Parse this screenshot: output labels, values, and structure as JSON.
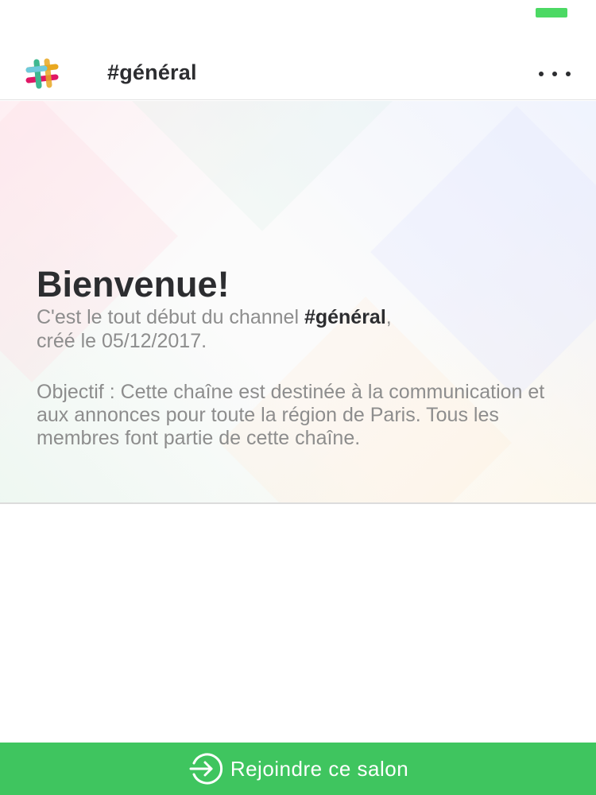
{
  "colors": {
    "accent_green": "#3fc55f",
    "battery_green": "#4cd964"
  },
  "header": {
    "channel_name": "#général",
    "logo_icon": "slack-logo-icon",
    "more_icon": "more-horizontal-icon"
  },
  "intro": {
    "title": "Bienvenue!",
    "created_prefix": "C'est le tout début du channel ",
    "created_channel": "#général",
    "created_suffix": ",",
    "created_date": "créé le 05/12/2017.",
    "purpose": "Objectif : Cette chaîne est destinée à la communication et aux annonces pour toute la région de Paris. Tous les membres font partie de cette chaîne."
  },
  "join": {
    "label": "Rejoindre ce salon",
    "icon": "enter-icon"
  }
}
